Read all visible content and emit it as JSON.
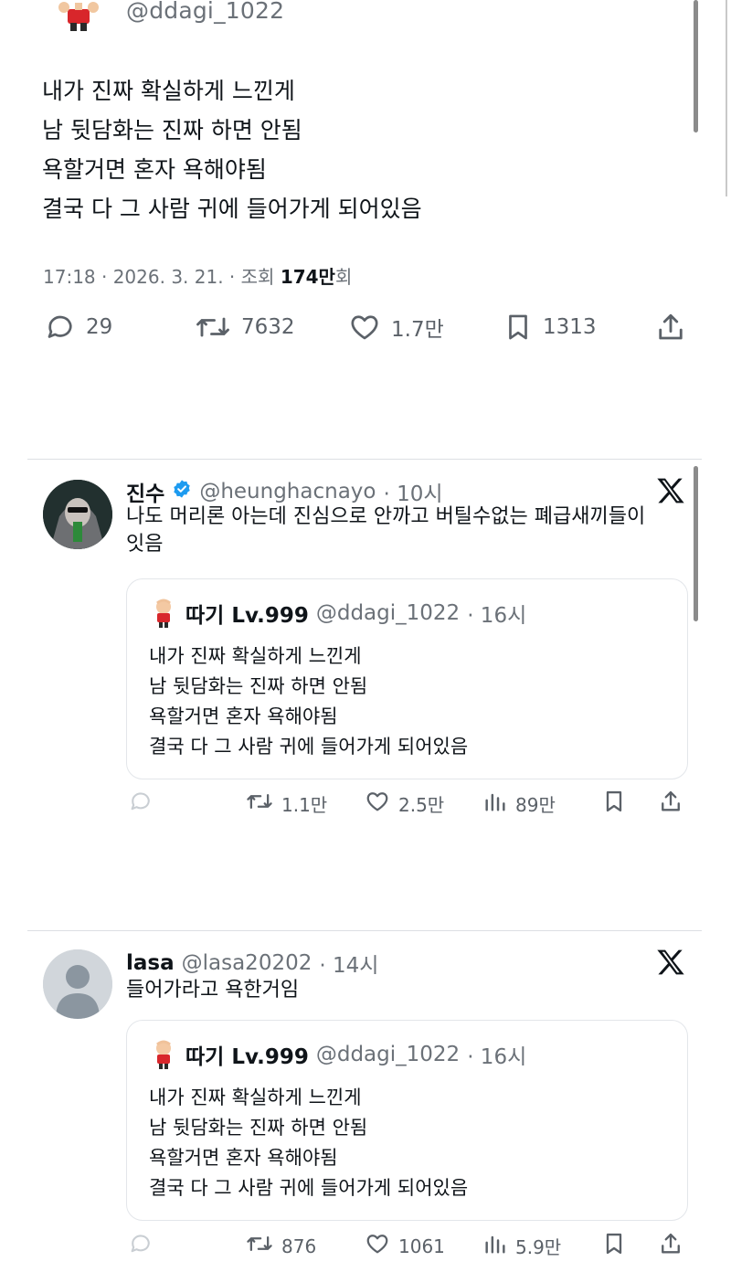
{
  "main_tweet": {
    "handle": "@ddagi_1022",
    "lines": [
      "내가 진짜 확실하게 느낀게",
      "남 뒷담화는 진짜 하면 안됨",
      "욕할거면 혼자 욕해야됨",
      "결국 다 그 사람 귀에 들어가게 되어있음"
    ],
    "meta_prefix": "17:18 · 2026. 3. 21. · 조회 ",
    "views": "174만",
    "views_suffix": "회",
    "replies": "29",
    "retweets": "7632",
    "likes": "1.7만",
    "bookmarks": "1313"
  },
  "replies": [
    {
      "name": "진수",
      "handle": "@heunghacnayo",
      "time": "· 10시",
      "lines": [
        "나도 머리론 아는데 진심으로 안까고 버틸수없는 폐급새끼들이",
        "잇음"
      ],
      "quote": {
        "name": "따기 Lv.999",
        "handle": "@ddagi_1022",
        "time": "· 16시",
        "lines": [
          "내가 진짜 확실하게 느낀게",
          "남 뒷담화는 진짜 하면 안됨",
          "욕할거면 혼자 욕해야됨",
          "결국 다 그 사람 귀에 들어가게 되어있음"
        ]
      },
      "retweets": "1.1만",
      "likes": "2.5만",
      "views": "89만"
    },
    {
      "name": "lasa",
      "handle": "@lasa20202",
      "time": "· 14시",
      "lines": [
        "들어가라고 욕한거임"
      ],
      "quote": {
        "name": "따기 Lv.999",
        "handle": "@ddagi_1022",
        "time": "· 16시",
        "lines": [
          "내가 진짜 확실하게 느낀게",
          "남 뒷담화는 진짜 하면 안됨",
          "욕할거면 혼자 욕해야됨",
          "결국 다 그 사람 귀에 들어가게 되어있음"
        ]
      },
      "retweets": "876",
      "likes": "1061",
      "views": "5.9만"
    }
  ],
  "colors": {
    "text": "#0f1419",
    "secondary": "#6b7178",
    "verified": "#1d9bf0",
    "divider": "#dcdfe3"
  },
  "icons": {
    "reply": "speech-bubble-icon",
    "retweet": "retweet-icon",
    "like": "heart-icon",
    "bookmark": "bookmark-icon",
    "share": "share-icon",
    "views": "bar-chart-icon",
    "brand": "x-logo-icon"
  }
}
